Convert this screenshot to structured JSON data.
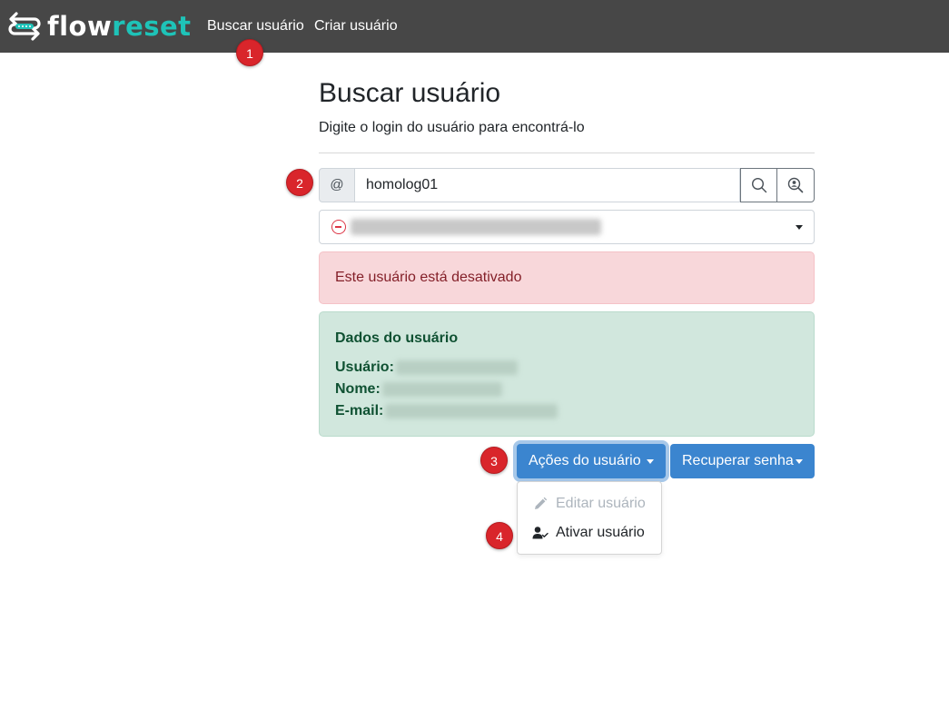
{
  "navbar": {
    "brand_flow": "flow",
    "brand_reset": "reset",
    "links": [
      "Buscar usuário",
      "Criar usuário"
    ]
  },
  "badges": [
    "1",
    "2",
    "3",
    "4"
  ],
  "page": {
    "title": "Buscar usuário",
    "subtitle": "Digite o login do usuário para encontrá-lo"
  },
  "search": {
    "prefix": "@",
    "value": "homolog01"
  },
  "alert_danger": "Este usuário está desativado",
  "user_info": {
    "title": "Dados do usuário",
    "usuario_label": "Usuário:",
    "nome_label": "Nome:",
    "email_label": "E-mail:"
  },
  "actions": {
    "acoes_label": "Ações do usuário",
    "recuperar_label": "Recuperar senha",
    "menu": [
      "Editar usuário",
      "Ativar usuário"
    ]
  },
  "colors": {
    "navbar": "#474747",
    "brand_accent": "#1ec3b8",
    "primary": "#3b85cf",
    "badge": "#d9252b"
  }
}
